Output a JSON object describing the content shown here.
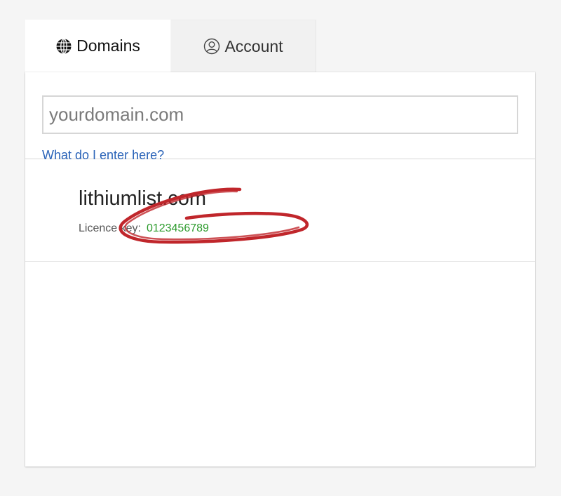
{
  "tabs": [
    {
      "label": "Domains",
      "icon": "globe-icon",
      "active": true
    },
    {
      "label": "Account",
      "icon": "user-circle-icon",
      "active": false
    }
  ],
  "search": {
    "placeholder": "yourdomain.com",
    "value": ""
  },
  "help_link": "What do I enter here?",
  "domains": [
    {
      "name": "lithiumlist.com",
      "licence_label": "Licence key:",
      "licence_key": "0123456789"
    }
  ],
  "colors": {
    "link": "#2a63b8",
    "licence_key": "#2b9a2b",
    "annotation": "#c0262b"
  }
}
